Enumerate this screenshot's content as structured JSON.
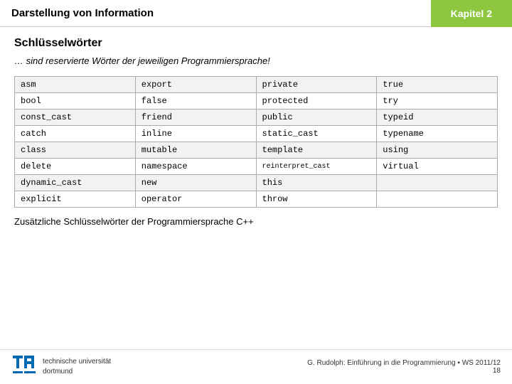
{
  "header": {
    "title": "Darstellung von Information",
    "badge": "Kapitel 2"
  },
  "section": {
    "title": "Schlüsselwörter",
    "subtitle": "… sind reservierte Wörter der jeweiligen Programmiersprache!"
  },
  "table": {
    "rows": [
      [
        "asm",
        "export",
        "private",
        "true"
      ],
      [
        "bool",
        "false",
        "protected",
        "try"
      ],
      [
        "const_cast",
        "friend",
        "public",
        "typeid"
      ],
      [
        "catch",
        "inline",
        "static_cast",
        "typename"
      ],
      [
        "class",
        "mutable",
        "template",
        "using"
      ],
      [
        "delete",
        "namespace",
        "reinterpret_cast",
        "virtual"
      ],
      [
        "dynamic_cast",
        "new",
        "this",
        ""
      ],
      [
        "explicit",
        "operator",
        "throw",
        ""
      ]
    ]
  },
  "additional": "Zusätzliche Schlüsselwörter der Programmiersprache C++",
  "footer": {
    "logo_line1": "technische universität",
    "logo_line2": "dortmund",
    "info_line1": "G. Rudolph: Einführung in die Programmierung ▪ WS 2011/12",
    "info_line2": "18"
  }
}
